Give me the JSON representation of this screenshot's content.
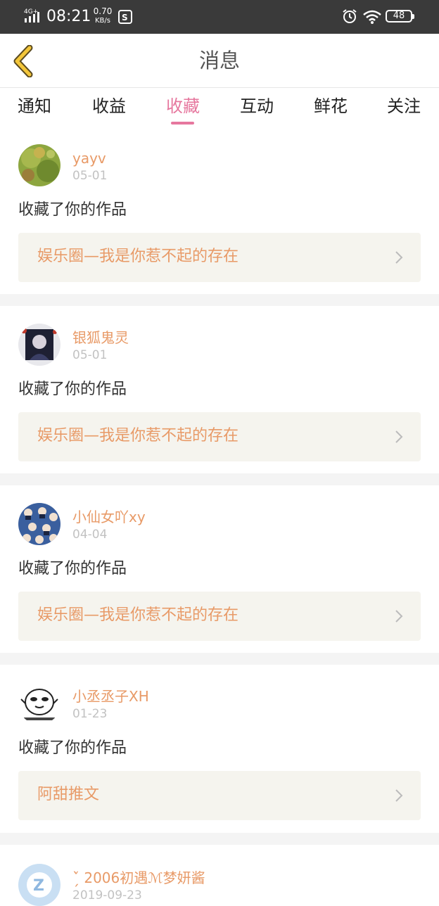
{
  "status_bar": {
    "network": "4G+",
    "time": "08:21",
    "speed_value": "0.70",
    "speed_unit": "KB/s",
    "battery": "48",
    "icons": [
      "signal-icon",
      "app-notification-icon",
      "alarm-icon",
      "wifi-icon",
      "battery-icon"
    ]
  },
  "header": {
    "title": "消息",
    "back_icon": "chevron-left-icon"
  },
  "tabs": [
    {
      "label": "通知"
    },
    {
      "label": "收益"
    },
    {
      "label": "收藏"
    },
    {
      "label": "互动"
    },
    {
      "label": "鲜花"
    },
    {
      "label": "关注"
    }
  ],
  "active_tab": "收藏",
  "accent_color": "#e6779e",
  "name_color": "#e89a67",
  "notifications": [
    {
      "username": "yayv",
      "date": "05-01",
      "action": "收藏了你的作品",
      "work_title": "娱乐圈—我是你惹不起的存在"
    },
    {
      "username": "银狐鬼灵",
      "date": "05-01",
      "action": "收藏了你的作品",
      "work_title": "娱乐圈—我是你惹不起的存在"
    },
    {
      "username": "小仙女吖xy",
      "date": "04-04",
      "action": "收藏了你的作品",
      "work_title": "娱乐圈—我是你惹不起的存在"
    },
    {
      "username": "小丞丞子XH",
      "date": "01-23",
      "action": "收藏了你的作品",
      "work_title": "阿甜推文"
    },
    {
      "username": "ˇ̗̀ 2006初遇ℳ梦妍酱",
      "date": "2019-09-23"
    }
  ]
}
